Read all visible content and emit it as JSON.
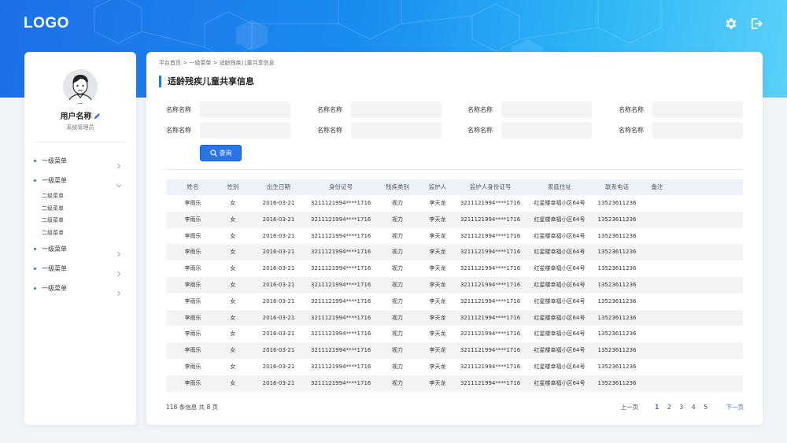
{
  "header": {
    "logo": "LOGO",
    "icons": [
      "gear-icon",
      "logout-icon"
    ]
  },
  "sidebar": {
    "user_name": "用户名称",
    "user_role": "系统管理员",
    "menu": [
      {
        "label": "一级菜单",
        "expanded": false
      },
      {
        "label": "一级菜单",
        "expanded": true,
        "children": [
          "二级菜单",
          "二级菜单",
          "二级菜单",
          "二级菜单"
        ]
      },
      {
        "label": "一级菜单",
        "expanded": false
      },
      {
        "label": "一级菜单",
        "expanded": false
      },
      {
        "label": "一级菜单",
        "expanded": false
      }
    ]
  },
  "main": {
    "breadcrumb": [
      "平台首页",
      "一级菜单",
      "适龄残疾儿童共享信息"
    ],
    "breadcrumb_sep": ">",
    "title": "适龄残疾儿童共享信息",
    "filters": [
      "名称名称",
      "名称名称",
      "名称名称",
      "名称名称",
      "名称名称",
      "名称名称",
      "名称名称",
      "名称名称"
    ],
    "query_label": "查询",
    "table": {
      "headers": [
        "姓名",
        "性别",
        "出生日期",
        "身份证号",
        "残疾类别",
        "监护人",
        "监护人身份证号",
        "家庭住址",
        "联系电话",
        "备注"
      ],
      "rows": [
        [
          "李雨乐",
          "女",
          "2016-03-21",
          "3211121994****1716",
          "视力",
          "李天龙",
          "3211121994****1716",
          "红星楼幸福小区64号",
          "13523611236",
          ""
        ],
        [
          "李雨乐",
          "女",
          "2016-03-21",
          "3211121994****1716",
          "视力",
          "李天龙",
          "3211121994****1716",
          "红星楼幸福小区64号",
          "13523611236",
          ""
        ],
        [
          "李雨乐",
          "女",
          "2016-03-21",
          "3211121994****1716",
          "视力",
          "李天龙",
          "3211121994****1716",
          "红星楼幸福小区64号",
          "13523611236",
          ""
        ],
        [
          "李雨乐",
          "女",
          "2016-03-21",
          "3211121994****1716",
          "视力",
          "李天龙",
          "3211121994****1716",
          "红星楼幸福小区64号",
          "13523611236",
          ""
        ],
        [
          "李雨乐",
          "女",
          "2016-03-21",
          "3211121994****1716",
          "视力",
          "李天龙",
          "3211121994****1716",
          "红星楼幸福小区64号",
          "13523611236",
          ""
        ],
        [
          "李雨乐",
          "女",
          "2016-03-21",
          "3211121994****1716",
          "视力",
          "李天龙",
          "3211121994****1716",
          "红星楼幸福小区64号",
          "13523611236",
          ""
        ],
        [
          "李雨乐",
          "女",
          "2016-03-21",
          "3211121994****1716",
          "视力",
          "李天龙",
          "3211121994****1716",
          "红星楼幸福小区64号",
          "13523611236",
          ""
        ],
        [
          "李雨乐",
          "女",
          "2016-03-21",
          "3211121994****1716",
          "视力",
          "李天龙",
          "3211121994****1716",
          "红星楼幸福小区64号",
          "13523611236",
          ""
        ],
        [
          "李雨乐",
          "女",
          "2016-03-21",
          "3211121994****1716",
          "视力",
          "李天龙",
          "3211121994****1716",
          "红星楼幸福小区64号",
          "13523611236",
          ""
        ],
        [
          "李雨乐",
          "女",
          "2016-03-21",
          "3211121994****1716",
          "视力",
          "李天龙",
          "3211121994****1716",
          "红星楼幸福小区64号",
          "13523611236",
          ""
        ],
        [
          "李雨乐",
          "女",
          "2016-03-21",
          "3211121994****1716",
          "视力",
          "李天龙",
          "3211121994****1716",
          "红星楼幸福小区64号",
          "13523611236",
          ""
        ],
        [
          "李雨乐",
          "女",
          "2016-03-21",
          "3211121994****1716",
          "视力",
          "李天龙",
          "3211121994****1716",
          "红星楼幸福小区64号",
          "13523611236",
          ""
        ]
      ]
    },
    "footer_info": "118 条信息 共 8 页",
    "pagination": {
      "prev": "上一页",
      "pages": [
        "1",
        "2",
        "3",
        "4",
        "5"
      ],
      "current": "1",
      "next": "下一页"
    }
  },
  "colors": {
    "accent": "#2a74e6",
    "banner_start": "#1d6fe8",
    "banner_end": "#5bd0f8"
  }
}
